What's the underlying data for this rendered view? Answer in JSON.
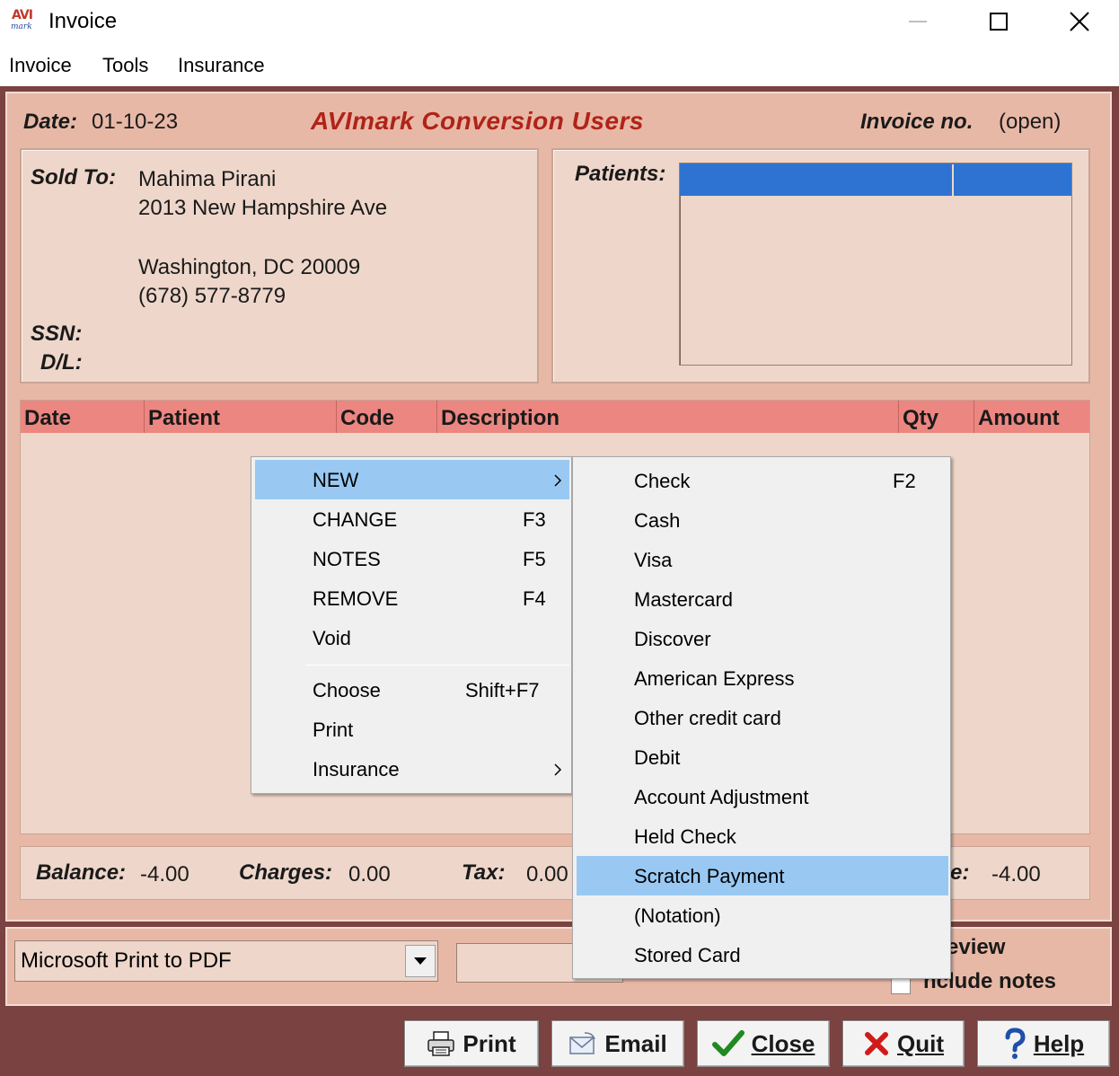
{
  "window": {
    "logo_top": "AVI",
    "logo_bottom": "mark",
    "title": "Invoice"
  },
  "menubar": [
    "Invoice",
    "Tools",
    "Insurance"
  ],
  "invoice": {
    "date_label": "Date:",
    "date": "01-10-23",
    "clinic": "AVImark Conversion Users",
    "invoice_no_label": "Invoice no.",
    "invoice_no": "(open)"
  },
  "sold_to": {
    "label": "Sold To:",
    "name": "Mahima Pirani",
    "address1": "2013 New Hampshire Ave",
    "city_state_zip": "Washington, DC  20009",
    "phone": "(678) 577-8779",
    "ssn_label": "SSN:",
    "dl_label": "D/L:"
  },
  "patients": {
    "label": "Patients:"
  },
  "grid": {
    "columns": [
      "Date",
      "Patient",
      "Code",
      "Description",
      "Qty",
      "Amount"
    ]
  },
  "totals": {
    "balance_label": "Balance:",
    "balance": "-4.00",
    "charges_label": "Charges:",
    "charges": "0.00",
    "tax_label": "Tax:",
    "tax": "0.00",
    "final_label_fragment": "e:",
    "final_value": "-4.00"
  },
  "print_options": {
    "printer": "Microsoft Print to PDF",
    "preview_fragment": "eview",
    "include_notes_fragment": "nclude notes"
  },
  "buttons": {
    "print": "Print",
    "email": "Email",
    "close": "Close",
    "quit": "Quit",
    "help": "Help"
  },
  "context_menu": {
    "items": [
      {
        "label": "NEW",
        "key": ""
      },
      {
        "label": "CHANGE",
        "key": "F3"
      },
      {
        "label": "NOTES",
        "key": "F5"
      },
      {
        "label": "REMOVE",
        "key": "F4"
      },
      {
        "label": "Void",
        "key": ""
      },
      {
        "label": "Choose",
        "key": "Shift+F7"
      },
      {
        "label": "Print",
        "key": ""
      },
      {
        "label": "Insurance",
        "key": ""
      }
    ]
  },
  "submenu": {
    "items": [
      {
        "label": "Check",
        "key": "F2"
      },
      {
        "label": "Cash"
      },
      {
        "label": "Visa"
      },
      {
        "label": "Mastercard"
      },
      {
        "label": "Discover"
      },
      {
        "label": "American Express"
      },
      {
        "label": "Other credit card"
      },
      {
        "label": "Debit"
      },
      {
        "label": "Account Adjustment"
      },
      {
        "label": "Held Check"
      },
      {
        "label": "Scratch Payment"
      },
      {
        "label": "(Notation)"
      },
      {
        "label": "Stored Card"
      }
    ]
  },
  "colors": {
    "panel": "#e8b8a6",
    "frame": "#7a4240",
    "grid_header": "#ec8680",
    "selection": "#2e73d1",
    "menu_highlight": "#99c9f3",
    "clinic_text": "#b02318"
  }
}
